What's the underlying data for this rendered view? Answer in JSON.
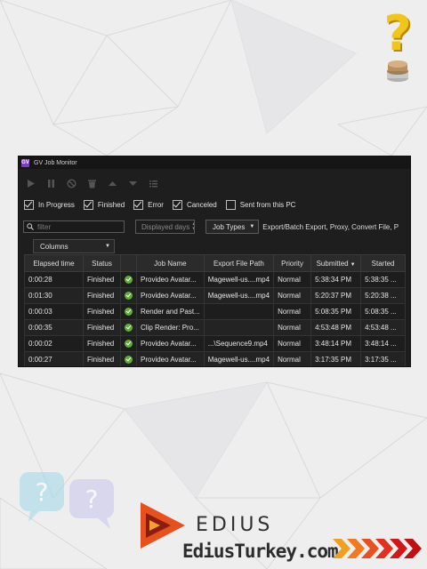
{
  "window": {
    "app_icon_text": "GV",
    "title": "GV Job Monitor"
  },
  "toolbar": {
    "icons": [
      "play-icon",
      "pause-icon",
      "cancel-icon",
      "delete-icon",
      "move-up-icon",
      "move-down-icon",
      "list-icon"
    ]
  },
  "filters": {
    "in_progress": {
      "label": "In Progress",
      "checked": true
    },
    "finished": {
      "label": "Finished",
      "checked": true
    },
    "error": {
      "label": "Error",
      "checked": true
    },
    "canceled": {
      "label": "Canceled",
      "checked": true
    },
    "sent_from_pc": {
      "label": "Sent from this PC",
      "checked": false
    }
  },
  "search": {
    "placeholder": "filter"
  },
  "displayed_days": {
    "placeholder": "Displayed days"
  },
  "job_types": {
    "label": "Job Types",
    "value": "Export/Batch Export, Proxy, Convert File, P"
  },
  "columns_button": {
    "label": "Columns"
  },
  "table": {
    "headers": {
      "elapsed": "Elapsed time",
      "status": "Status",
      "icon": "",
      "job_name": "Job Name",
      "export_path": "Export File Path",
      "priority": "Priority",
      "submitted": "Submitted",
      "started": "Started"
    },
    "sorted_column": "submitted",
    "sort_direction": "descending",
    "rows": [
      {
        "elapsed": "0:00:28",
        "status": "Finished",
        "job_name": "Provideo Avatar...",
        "export_path": "Magewell-us....mp4",
        "priority": "Normal",
        "submitted": "5:38:34 PM",
        "started": "5:38:35 ..."
      },
      {
        "elapsed": "0:01:30",
        "status": "Finished",
        "job_name": "Provideo Avatar...",
        "export_path": "Magewell-us....mp4",
        "priority": "Normal",
        "submitted": "5:20:37 PM",
        "started": "5:20:38 ..."
      },
      {
        "elapsed": "0:00:03",
        "status": "Finished",
        "job_name": "Render and Past...",
        "export_path": "",
        "priority": "Normal",
        "submitted": "5:08:35 PM",
        "started": "5:08:35 ..."
      },
      {
        "elapsed": "0:00:35",
        "status": "Finished",
        "job_name": "Clip Render: Pro...",
        "export_path": "",
        "priority": "Normal",
        "submitted": "4:53:48 PM",
        "started": "4:53:48 ..."
      },
      {
        "elapsed": "0:00:02",
        "status": "Finished",
        "job_name": "Provideo Avatar...",
        "export_path": "...\\Sequence9.mp4",
        "priority": "Normal",
        "submitted": "3:48:14 PM",
        "started": "3:48:14 ..."
      },
      {
        "elapsed": "0:00:27",
        "status": "Finished",
        "job_name": "Provideo Avatar...",
        "export_path": "Magewell-us....mp4",
        "priority": "Normal",
        "submitted": "3:17:35 PM",
        "started": "3:17:35 ..."
      }
    ]
  },
  "branding": {
    "product": "EDIUS",
    "site": "EdiusTurkey.com"
  },
  "colors": {
    "accent_purple": "#7a3fbf",
    "status_green": "#5fb030",
    "window_bg": "#1e1e1e",
    "logo_orange": "#e8501e"
  }
}
